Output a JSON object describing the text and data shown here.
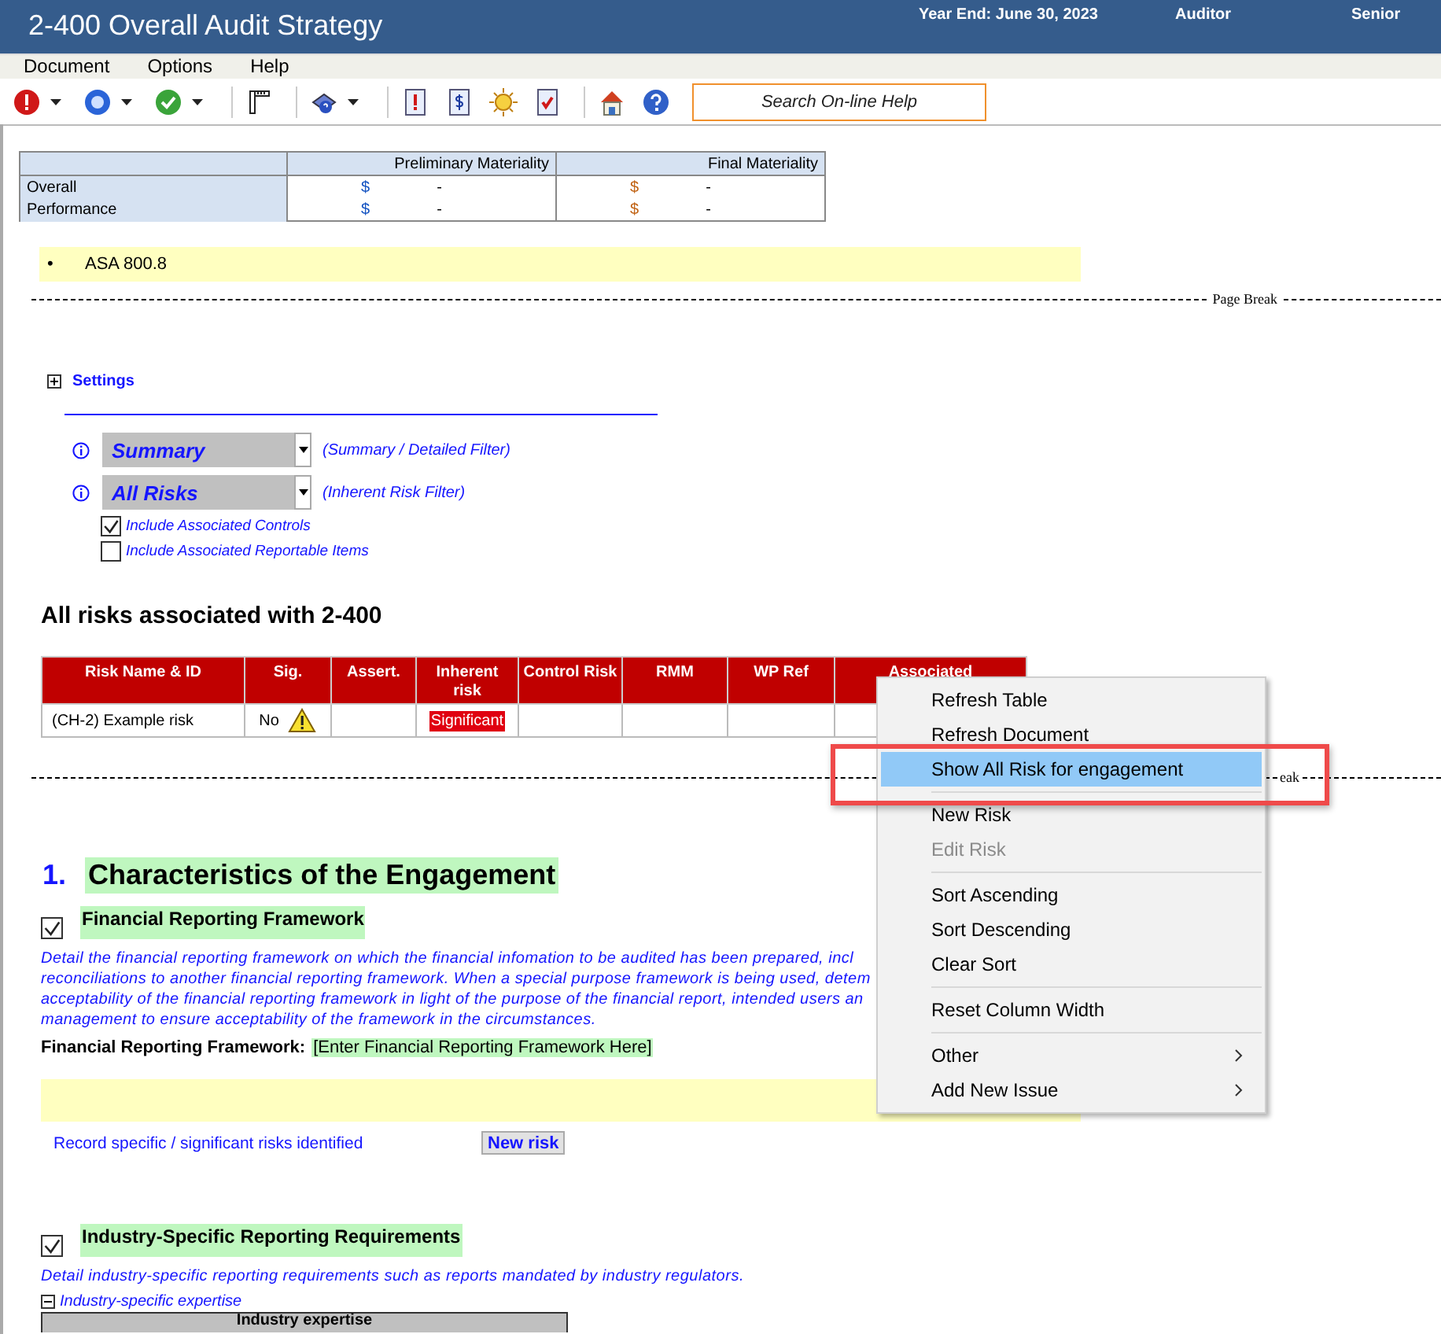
{
  "window": {
    "title": "2-400 Overall Audit Strategy",
    "year_end": "Year End: June 30, 2023",
    "auditor": "Auditor",
    "reviewer": "Senior"
  },
  "menu_bar": [
    "Document",
    "Options",
    "Help"
  ],
  "search": {
    "placeholder": "Search On-line Help"
  },
  "materiality": {
    "columns": [
      "Preliminary Materiality",
      "Final Materiality"
    ],
    "rows": [
      {
        "label": "Overall",
        "cells": [
          {
            "currency": "$",
            "value": "-"
          },
          {
            "currency": "$",
            "value": "-"
          }
        ]
      },
      {
        "label": "Performance",
        "cells": [
          {
            "currency": "$",
            "value": "-"
          },
          {
            "currency": "$",
            "value": "-"
          }
        ]
      }
    ]
  },
  "note": {
    "bullets": [
      {
        "marker": "•",
        "text": "ASA 800.8"
      }
    ]
  },
  "page_break_top": {
    "label": "Page Break"
  },
  "settings": {
    "label": "Settings",
    "expanded": false
  },
  "filters": [
    {
      "value": "Summary",
      "hint": "(Summary / Detailed Filter)"
    },
    {
      "value": "All Risks",
      "hint": "(Inherent Risk Filter)"
    }
  ],
  "options": [
    {
      "label": "Include Associated Controls",
      "checked": true
    },
    {
      "label": "Include Associated Reportable Items",
      "checked": false
    }
  ],
  "risks": {
    "title": "All risks associated with 2-400",
    "columns": [
      "Risk Name & ID",
      "Sig.",
      "Assert.",
      "Inherent risk",
      "Control Risk",
      "RMM",
      "WP Ref",
      "Associated"
    ],
    "rows": [
      {
        "name": "(CH-2) Example risk",
        "sig": "No",
        "warning": true,
        "inherent": "Significant"
      }
    ]
  },
  "page_break_bottom": {
    "label": "eak"
  },
  "section": {
    "number": "1.",
    "title": "Characteristics of the Engagement",
    "items": [
      {
        "checked": true,
        "title": "Financial Reporting Framework",
        "description_lines": [
          "Detail the financial reporting framework on which the financial infomation to be audited has been prepared, incl",
          "reconciliations to another financial reporting framework. When a special purpose framework is being used, detem",
          "acceptability of the financial reporting framework in light of the purpose of the financial report, intended users an",
          "management to ensure acceptability of the framework in the circumstances."
        ],
        "field_label": "Financial Reporting Framework:",
        "field_value": "[Enter Financial Reporting Framework Here]",
        "link": "Record specific / significant risks identified",
        "button": "New risk"
      },
      {
        "checked": true,
        "title": "Industry-Specific Reporting Requirements",
        "description_lines": [
          "Detail industry-specific reporting requirements such as reports mandated by industry regulators."
        ],
        "subsection": {
          "label": "Industry-specific expertise",
          "expanded": true,
          "table_header": "Industry expertise"
        }
      }
    ]
  },
  "context_menu": {
    "items": [
      {
        "kind": "item",
        "label": "Refresh Table",
        "selected": false,
        "disabled": false,
        "submenu": false
      },
      {
        "kind": "item",
        "label": "Refresh Document",
        "selected": false,
        "disabled": false,
        "submenu": false
      },
      {
        "kind": "item",
        "label": "Show All Risk for engagement",
        "selected": true,
        "disabled": false,
        "submenu": false
      },
      {
        "kind": "separator"
      },
      {
        "kind": "item",
        "label": "New Risk",
        "selected": false,
        "disabled": false,
        "submenu": false
      },
      {
        "kind": "item",
        "label": "Edit Risk",
        "selected": false,
        "disabled": true,
        "submenu": false
      },
      {
        "kind": "separator"
      },
      {
        "kind": "item",
        "label": "Sort Ascending",
        "selected": false,
        "disabled": false,
        "submenu": false
      },
      {
        "kind": "item",
        "label": "Sort Descending",
        "selected": false,
        "disabled": false,
        "submenu": false
      },
      {
        "kind": "item",
        "label": "Clear Sort",
        "selected": false,
        "disabled": false,
        "submenu": false
      },
      {
        "kind": "separator"
      },
      {
        "kind": "item",
        "label": "Reset Column Width",
        "selected": false,
        "disabled": false,
        "submenu": false
      },
      {
        "kind": "separator"
      },
      {
        "kind": "item",
        "label": "Other",
        "selected": false,
        "disabled": false,
        "submenu": true
      },
      {
        "kind": "item",
        "label": "Add New Issue",
        "selected": false,
        "disabled": false,
        "submenu": true
      }
    ]
  }
}
